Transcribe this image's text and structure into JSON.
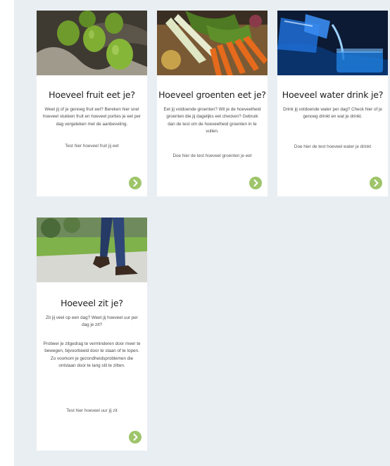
{
  "cards": [
    {
      "title": "Hoeveel fruit eet je?",
      "description": "Weet jij of je genoeg fruit eet? Bereken hier snel hoeveel stukken fruit en hoeveel porties je eet per dag vergeleken met de aanbeveling.",
      "link": "Test hier hoeveel fruit jij eet"
    },
    {
      "title": "Hoeveel groenten eet je?",
      "description": "Eet jij voldoende groenten? Wil je de hoeveelheid groenten die jij dagelijks eet checken? Gebruik dan de test om de hoeveelheid groenten in te vullen.",
      "link": "Doe hier de test hoeveel groenten je eet"
    },
    {
      "title": "Hoeveel water drink je?",
      "description": "Drink jij voldoende water per dag? Check hier of je genoeg drinkt en wat je drinkt.",
      "link": "Doe hier de test hoeveel water je drinkt"
    },
    {
      "title": "Hoeveel zit je?",
      "description_1": "Zit jij veel op een dag? Weet jij hoeveel uur per dag je zit?",
      "description_2": "Probeer je zitgedrag te verminderen door meer te bewegen, bijvoorbeeld door te staan of te lopen. Zo voorkom je gezondheidsproblemen die ontstaan door te lang stil te zitten.",
      "link": "Test hier hoeveel uur jij zit"
    }
  ],
  "icons": {
    "arrow": "arrow-right-circle-icon"
  },
  "colors": {
    "background_panel": "#e9eef2",
    "arrow_green": "#9ec56a",
    "highlight_blue": "#6b93c4"
  }
}
